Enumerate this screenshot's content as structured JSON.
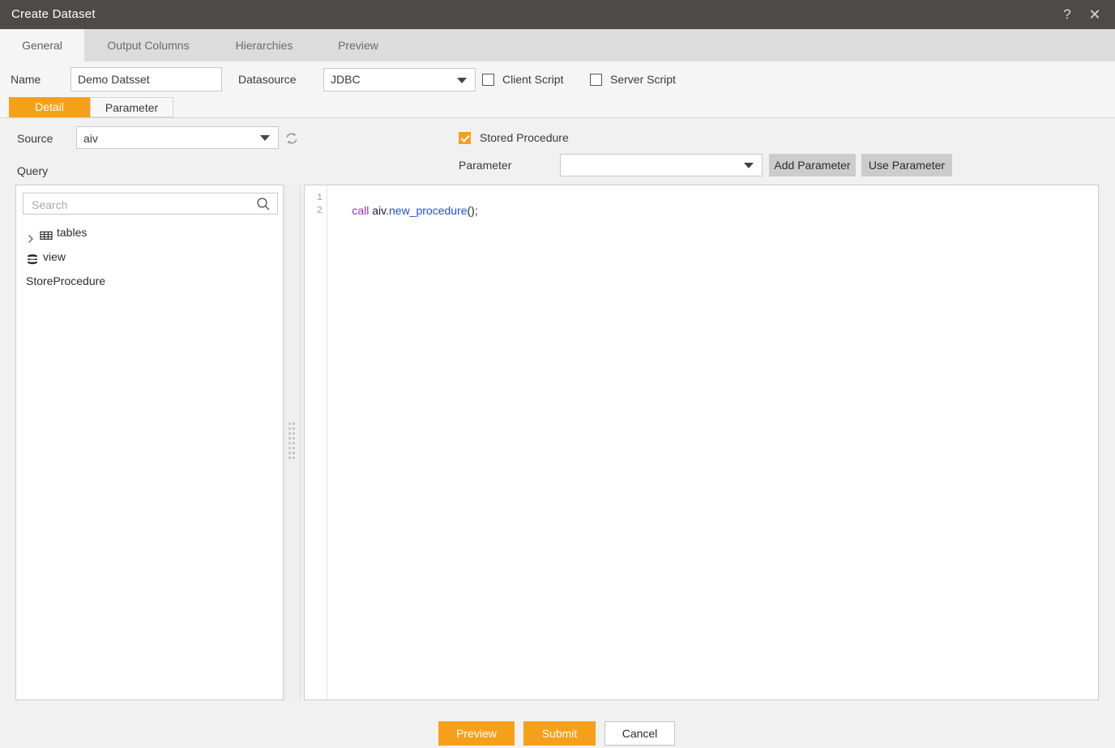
{
  "window": {
    "title": "Create Dataset",
    "help_icon": "question-mark-icon",
    "close_icon": "close-icon"
  },
  "tabs": [
    {
      "label": "General",
      "active": true
    },
    {
      "label": "Output Columns",
      "active": false
    },
    {
      "label": "Hierarchies",
      "active": false
    },
    {
      "label": "Preview",
      "active": false
    }
  ],
  "form": {
    "name_label": "Name",
    "name_value": "Demo Datsset",
    "name_placeholder": "",
    "datasource_label": "Datasource",
    "datasource_value": "JDBC",
    "client_script_label": "Client Script",
    "client_script_checked": false,
    "server_script_label": "Server Script",
    "server_script_checked": false
  },
  "subtabs": [
    {
      "label": "Detail",
      "active": true
    },
    {
      "label": "Parameter",
      "active": false
    }
  ],
  "detail": {
    "source_label": "Source",
    "source_value": "aiv",
    "refresh_icon": "refresh-icon",
    "query_label": "Query",
    "stored_procedure_label": "Stored Procedure",
    "stored_procedure_checked": true,
    "parameter_label": "Parameter",
    "parameter_value": "",
    "add_parameter_label": "Add Parameter",
    "use_parameter_label": "Use Parameter"
  },
  "tree": {
    "search_placeholder": "Search",
    "search_value": "",
    "search_icon": "search-icon",
    "items": [
      {
        "label": "tables",
        "icon": "table-grid-icon",
        "expandable": true
      },
      {
        "label": "view",
        "icon": "database-stack-icon",
        "expandable": false
      },
      {
        "label": "StoreProcedure",
        "icon": "",
        "expandable": false
      }
    ]
  },
  "editor": {
    "line_numbers": [
      "1",
      "2"
    ],
    "lines": [
      [
        {
          "text": "call ",
          "type": "keyword"
        },
        {
          "text": "aiv.",
          "type": "schema"
        },
        {
          "text": "new_procedure",
          "type": "function"
        },
        {
          "text": "();",
          "type": "plain"
        }
      ],
      []
    ]
  },
  "footer": {
    "preview_label": "Preview",
    "submit_label": "Submit",
    "cancel_label": "Cancel"
  },
  "colors": {
    "accent": "#f6a01a",
    "titlebar": "#4d4b49",
    "tabstrip": "#dcdcdc",
    "panel": "#f1f1f1",
    "keyword": "#9b30b8",
    "function": "#2050d8"
  }
}
